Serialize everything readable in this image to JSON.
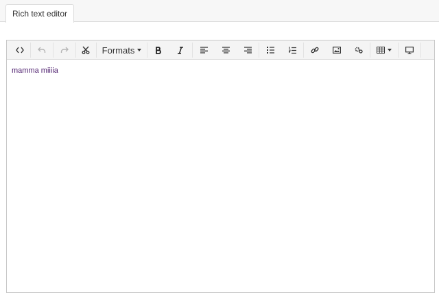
{
  "tab": {
    "label": "Rich text editor"
  },
  "toolbar": {
    "formats_label": "Formats",
    "buttons": [
      {
        "icon": "source-code-icon"
      },
      {
        "icon": "undo-icon",
        "disabled": true
      },
      {
        "icon": "redo-icon",
        "disabled": true
      },
      {
        "icon": "cut-icon"
      },
      {
        "icon": "formats-dropdown"
      },
      {
        "icon": "bold-icon"
      },
      {
        "icon": "italic-icon"
      },
      {
        "icon": "align-left-icon"
      },
      {
        "icon": "align-center-icon"
      },
      {
        "icon": "align-right-icon"
      },
      {
        "icon": "bullet-list-icon"
      },
      {
        "icon": "numbered-list-icon"
      },
      {
        "icon": "link-icon"
      },
      {
        "icon": "image-icon"
      },
      {
        "icon": "macro-icon"
      },
      {
        "icon": "table-icon"
      },
      {
        "icon": "preview-icon"
      }
    ]
  },
  "editor": {
    "content": "mamma miiiia",
    "text_color": "#4a1a6b"
  }
}
